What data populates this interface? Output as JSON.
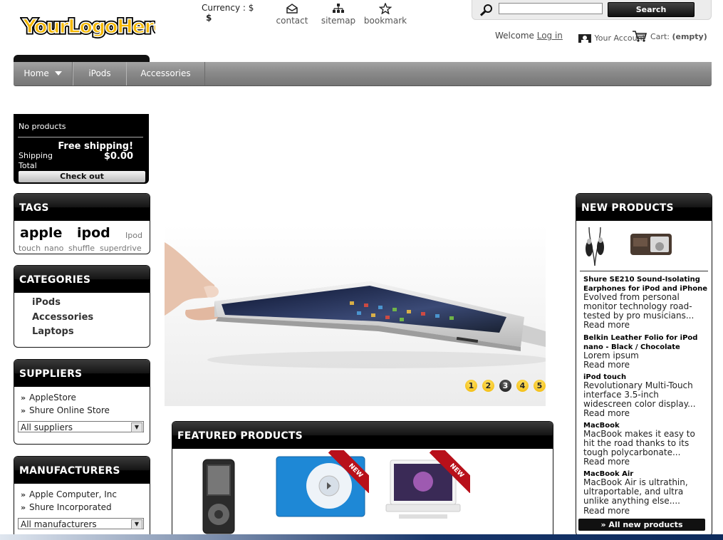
{
  "header": {
    "logo_text": "YourLogoHere",
    "currency_label": "Currency : $",
    "currency_value": "$",
    "links": [
      {
        "label": "contact",
        "icon": "envelope-icon"
      },
      {
        "label": "sitemap",
        "icon": "sitemap-icon"
      },
      {
        "label": "bookmark",
        "icon": "star-icon"
      }
    ],
    "search": {
      "placeholder": "",
      "button": "Search"
    },
    "welcome": "Welcome",
    "login": "Log in",
    "account": "Your Account",
    "cart_label": "Cart:",
    "cart_value": "(empty)"
  },
  "nav": {
    "items": [
      {
        "label": "Home",
        "has_dropdown": true
      },
      {
        "label": "iPods",
        "has_dropdown": false
      },
      {
        "label": "Accessories",
        "has_dropdown": false
      }
    ]
  },
  "cart_block": {
    "no_products": "No products",
    "free_shipping": "Free shipping!",
    "shipping_label": "Shipping",
    "shipping_value": "$0.00",
    "total_label": "Total",
    "checkout": "Check out"
  },
  "tags": {
    "title": "TAGS",
    "items": [
      {
        "label": "apple",
        "size": "large"
      },
      {
        "label": "ipod",
        "size": "large"
      },
      {
        "label": "Ipod",
        "size": "small"
      },
      {
        "label": "touch",
        "size": "small"
      },
      {
        "label": "nano",
        "size": "small"
      },
      {
        "label": "shuffle",
        "size": "small"
      },
      {
        "label": "superdrive",
        "size": "small"
      }
    ]
  },
  "categories": {
    "title": "CATEGORIES",
    "items": [
      "iPods",
      "Accessories",
      "Laptops"
    ]
  },
  "suppliers": {
    "title": "SUPPLIERS",
    "items": [
      "AppleStore",
      "Shure Online Store"
    ],
    "select": "All suppliers"
  },
  "manufacturers": {
    "title": "MANUFACTURERS",
    "items": [
      "Apple Computer, Inc",
      "Shure Incorporated"
    ],
    "select": "All manufacturers"
  },
  "slider": {
    "pages": [
      "1",
      "2",
      "3",
      "4",
      "5"
    ],
    "active_page": "3"
  },
  "featured": {
    "title": "FEATURED PRODUCTS",
    "badge": "NEW"
  },
  "new_products": {
    "title": "NEW PRODUCTS",
    "items": [
      {
        "title": "Shure SE210 Sound-Isolating Earphones for iPod and iPhone",
        "desc": "Evolved from personal monitor technology road-tested by pro musicians...",
        "more": "Read more"
      },
      {
        "title": "Belkin Leather Folio for iPod nano - Black / Chocolate",
        "desc": "Lorem ipsum",
        "more": "Read more"
      },
      {
        "title": "iPod touch",
        "desc": "Revolutionary Multi-Touch interface 3.5-inch widescreen color display...",
        "more": "Read more"
      },
      {
        "title": "MacBook",
        "desc": "MacBook makes it easy to hit the road thanks to its tough polycarbonate...",
        "more": "Read more"
      },
      {
        "title": "MacBook Air",
        "desc": "MacBook Air is ultrathin, ultraportable, and ultra unlike anything else....",
        "more": "Read more"
      }
    ],
    "all_button": "» All new products"
  }
}
